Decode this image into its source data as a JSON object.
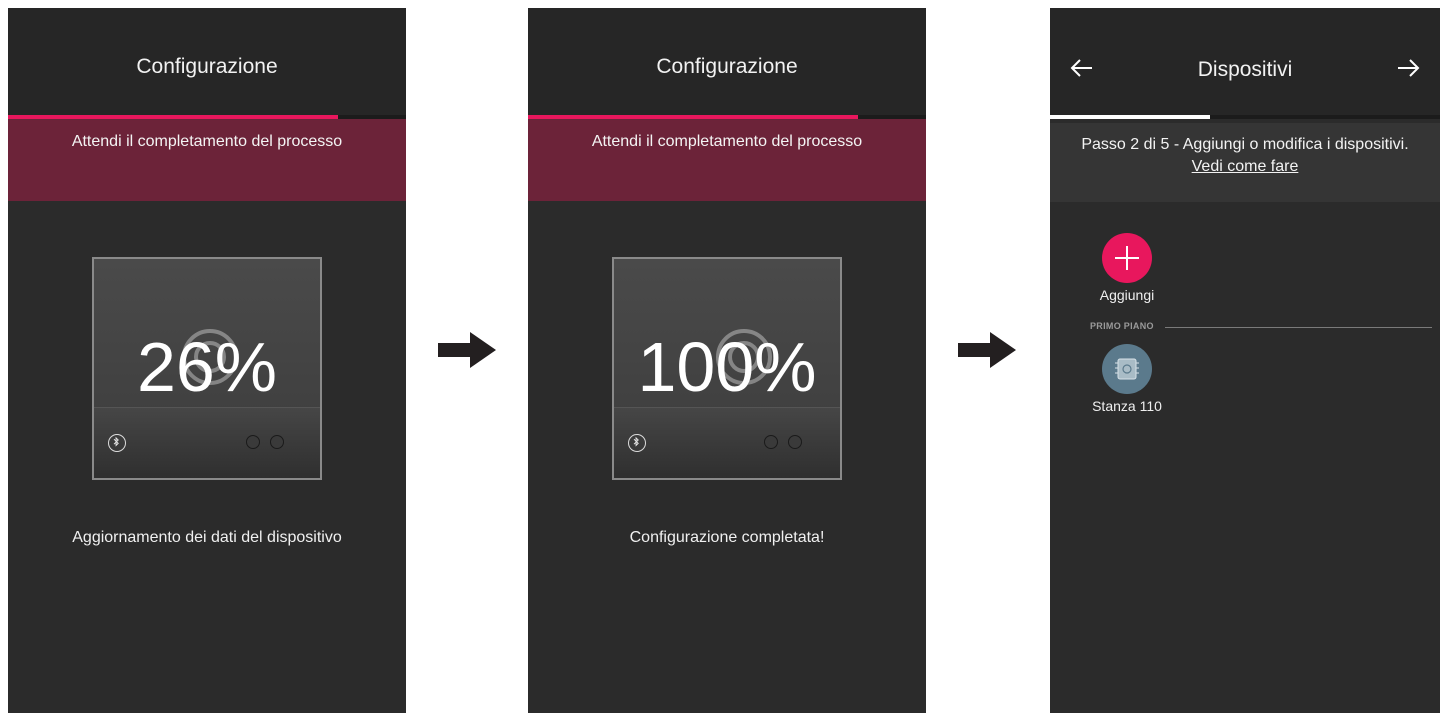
{
  "screens": [
    {
      "title": "Configurazione",
      "progress_fraction": 0.83,
      "banner": "Attendi il completamento del processo",
      "percent": "26%",
      "status": "Aggiornamento dei dati del dispositivo"
    },
    {
      "title": "Configurazione",
      "progress_fraction": 0.83,
      "banner": "Attendi il completamento del processo",
      "percent": "100%",
      "status": "Configurazione completata!"
    },
    {
      "title": "Dispositivi",
      "progress_fraction": 0.41,
      "step_text": "Passo 2 di 5 - Aggiungi o modifica i dispositivi.",
      "step_link": "Vedi come fare",
      "add_label": "Aggiungi",
      "section_label": "PRIMO PIANO",
      "room_label": "Stanza 110"
    }
  ],
  "colors": {
    "accent": "#e8175d",
    "banner": "#6c2339",
    "screen_bg": "#2b2b2b",
    "progress_screen3": "#ffffff"
  },
  "icons": [
    "bluetooth-icon",
    "arrow-right-icon",
    "back-arrow-icon",
    "forward-arrow-icon",
    "plus-icon",
    "device-module-icon"
  ]
}
